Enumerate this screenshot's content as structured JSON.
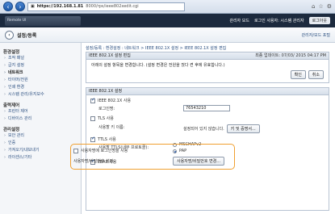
{
  "browser": {
    "url_host": "https://192.168.1.81",
    "url_rest": "8000/rps/ieee802xedit.cgi"
  },
  "topbar": {
    "logo_text": "Remote UI",
    "mode_label": "관리자 모드",
    "user_label": "로그인 사용자: 시스템 관리자",
    "logout_label": "로그아웃"
  },
  "header": {
    "title": "설정/등록",
    "portal_link": "관리자/모드 포털"
  },
  "sidebar": {
    "sections": [
      {
        "title": "환경설정",
        "items": [
          "조작 패널",
          "급지 설정",
          "네트워크",
          "타이머/전원",
          "인쇄 환경",
          "시스템 관리/유지보수"
        ]
      },
      {
        "title": "출력제어",
        "items": [
          "프린터 제어",
          "디바이스 관리"
        ]
      },
      {
        "title": "관리설정",
        "items": [
          "보안 관리",
          "인증",
          "가져오기/내보내기",
          "라이센스/기타"
        ]
      }
    ],
    "active_item": "네트워크"
  },
  "breadcrumb": "설정/등록 : 환경설정 : 네트워크 > IEEE 802.1X 설정 > IEEE 802.1X 설정 편집",
  "edit_panel": {
    "title": "IEEE 802.1X 설정 편집",
    "updated": "최종 업데이트: 07/03/ 2015 04:17 PM",
    "message": "아래의 설정 항목을 변경합니다. (설정 변경은 전원을 껐다 켠 후에 유효합니다.)",
    "ok_label": "확인",
    "cancel_label": "취소"
  },
  "settings_panel": {
    "title": "IEEE 802.1X 설정",
    "use_ieee": "IEEE 802.1X 사용",
    "login_name_label": "로그인명:",
    "login_name_value": "76543210",
    "tls_label": "TLS 사용",
    "key_label": "사용할 키 이름:",
    "key_value": "설정되어 있지 않습니다.",
    "key_button": "키 및 증명서...",
    "ttls_label": "TTLS 사용",
    "ttls_protocol_label": "사용할 TTLS(내부 프로토콜):",
    "protocol_options": [
      "MSCHAPv2",
      "PAP"
    ],
    "protocol_selected": "PAP",
    "peap_label": "PEAP 사용",
    "use_login_name_label": "사용자명에 로그인명을 사용",
    "username_password_label": "사용자명/비밀번호 설정:",
    "username_password_button": "사용자명/비밀번호 변경..."
  }
}
